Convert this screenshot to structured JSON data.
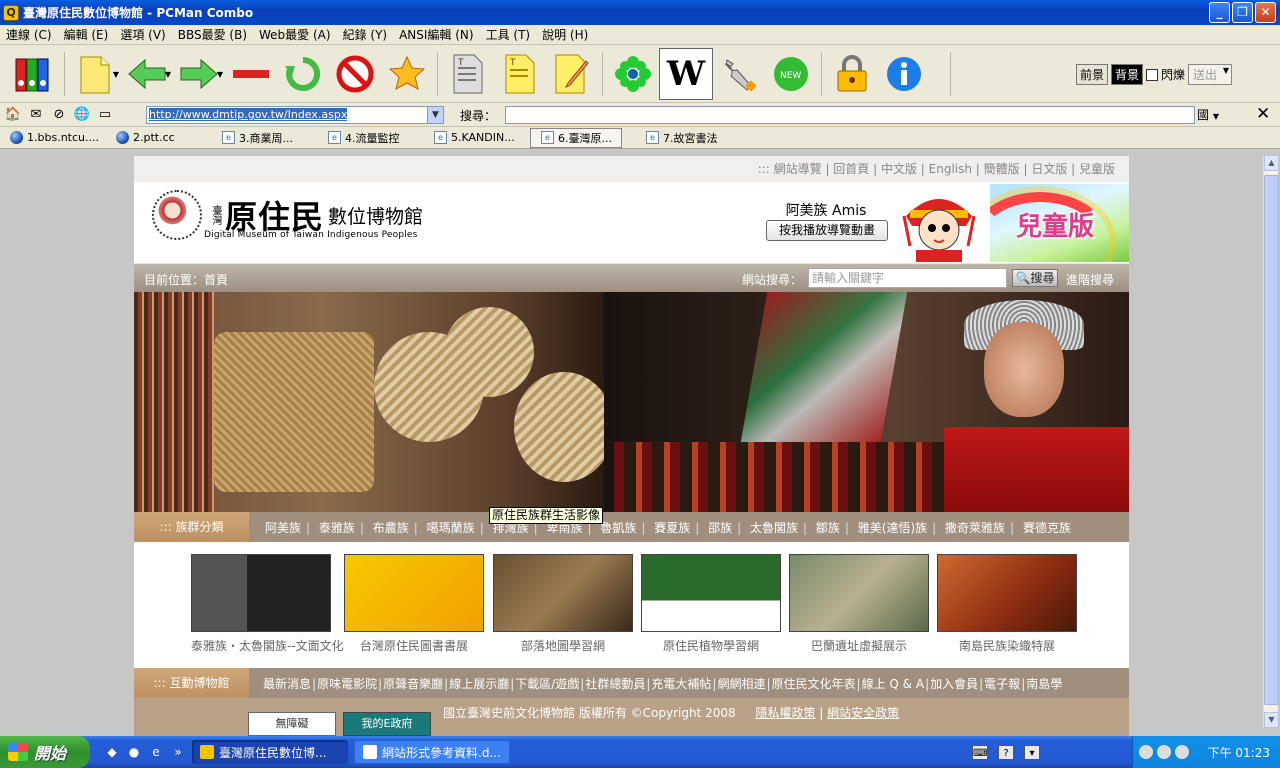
{
  "window": {
    "title": "臺灣原住民數位博物館 - PCMan Combo"
  },
  "menubar": [
    "連線 (C)",
    "編輯 (E)",
    "選項 (V)",
    "BBS最愛 (B)",
    "Web最愛 (A)",
    "紀錄 (Y)",
    "ANSI編輯 (N)",
    "工具 (T)",
    "說明 (H)"
  ],
  "toolbar": {
    "icons": [
      "connect-books-icon",
      "new-page-icon",
      "back-arrow-icon",
      "forward-arrow-icon",
      "stop-minus-icon",
      "refresh-icon",
      "no-entry-icon",
      "favorite-star-icon",
      "text-document-icon",
      "text-note-icon",
      "edit-note-icon",
      "snowflake-icon",
      "wikipedia-icon",
      "wrench-icon",
      "new-badge-icon",
      "lock-icon",
      "info-icon"
    ],
    "view": {
      "foreground_label": "前景",
      "background_label": "背景",
      "blink_label": "閃爍",
      "send_label": "送出"
    }
  },
  "address": {
    "url": "http://www.dmtip.gov.tw/Index.aspx",
    "search_label": "搜尋：",
    "search_value": "",
    "country_label": "國"
  },
  "tabs": [
    {
      "label": "1.bbs.ntcu....",
      "icon": "globe-icon"
    },
    {
      "label": "2.ptt.cc",
      "icon": "globe-icon"
    },
    {
      "label": "3.商業周...",
      "icon": "web-page-icon"
    },
    {
      "label": "4.流量監控",
      "icon": "web-page-icon"
    },
    {
      "label": "5.KANDIN...",
      "icon": "web-page-icon"
    },
    {
      "label": "6.臺灣原...",
      "icon": "web-page-icon",
      "active": true
    },
    {
      "label": "7.故宮書法",
      "icon": "web-page-icon"
    }
  ],
  "site": {
    "top_links": "::: 網站導覽 | 回首頁 | 中文版 | English | 簡體版 | 日文版 | 兒童版",
    "logo": {
      "small": "臺灣",
      "big": "原住民",
      "title": "數位博物館",
      "eng": "Digital Museum of Taiwan Indigenous Peoples"
    },
    "amis": {
      "label": "阿美族 Amis",
      "button": "按我播放導覽動畫"
    },
    "kids": "兒童版",
    "location": "目前位置：首頁",
    "search": {
      "label": "網站搜尋：",
      "placeholder": "請輸入關鍵字",
      "button": "搜尋",
      "advanced": "進階搜尋"
    },
    "tooltip": "原住民族群生活影像",
    "tribe_header": "::: 族群分類",
    "tribes": [
      "阿美族",
      "泰雅族",
      "布農族",
      "噶瑪蘭族",
      "排灣族",
      "卑南族",
      "魯凱族",
      "賽夏族",
      "邵族",
      "太魯閣族",
      "鄒族",
      "雅美(達悟)族",
      "撒奇萊雅族",
      "賽德克族"
    ],
    "thumbs": [
      {
        "caption": "泰雅族・太魯閣族--文面文化"
      },
      {
        "caption": "台灣原住民圖書書展"
      },
      {
        "caption": "部落地圖學習網"
      },
      {
        "caption": "原住民植物學習網"
      },
      {
        "caption": "巴蘭遺址虛擬展示"
      },
      {
        "caption": "南島民族染織特展"
      }
    ],
    "interactive_header": "::: 互動博物館",
    "interactive": [
      "最新消息",
      "原味電影院",
      "原聲音樂廳",
      "線上展示廳",
      "下載區/遊戲",
      "社群總動員",
      "充電大補帖",
      "網網相連",
      "原住民文化年表",
      "線上 Q & A",
      "加入會員",
      "電子報",
      "南島學"
    ],
    "footer": {
      "copyright": "國立臺灣史前文化博物館 版權所有 ©Copyright 2008",
      "privacy": "隱私權政策",
      "security": "網站安全政策",
      "banner1": "無障礙",
      "banner2": "我的E政府"
    }
  },
  "taskbar": {
    "start": "開始",
    "tasks": [
      {
        "label": "臺灣原住民數位博...",
        "active": true
      },
      {
        "label": "網站形式參考資料.d...",
        "active": false
      }
    ],
    "clock": "下午 01:23"
  }
}
